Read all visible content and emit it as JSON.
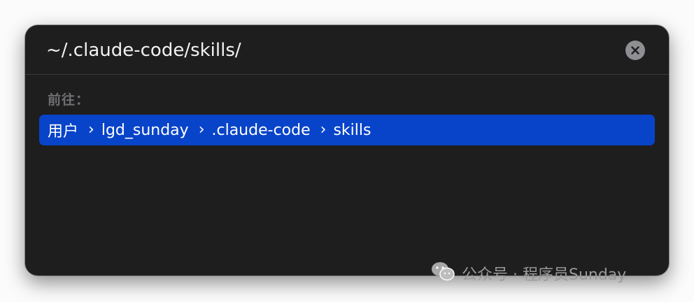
{
  "path_bar": {
    "value": "~/.claude-code/skills/"
  },
  "goto": {
    "label": "前往："
  },
  "suggestion": {
    "crumbs": [
      "用户",
      "lgd_sunday",
      ".claude-code",
      "skills"
    ],
    "separator": "›"
  },
  "watermark": {
    "text": "公众号 · 程序员Sunday"
  },
  "icons": {
    "clear": "close-circle-icon",
    "watermark": "wechat-icon",
    "separator": "chevron-right-icon"
  },
  "colors": {
    "dialog_bg": "#1e1e1e",
    "highlight": "#0844c9",
    "clear_button": "#8e8e93"
  }
}
